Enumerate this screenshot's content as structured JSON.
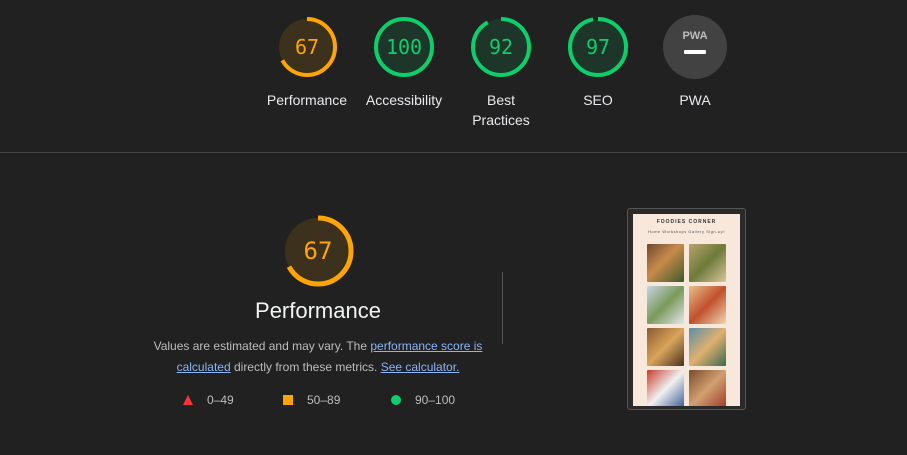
{
  "categories": [
    {
      "id": "performance",
      "score": "67",
      "label": "Performance",
      "fraction": 0.67,
      "color": "#ffa400"
    },
    {
      "id": "accessibility",
      "score": "100",
      "label": "Accessibility",
      "fraction": 1.0,
      "color": "#0cce6b"
    },
    {
      "id": "best-practices",
      "score": "92",
      "label": "Best Practices",
      "fraction": 0.92,
      "color": "#0cce6b"
    },
    {
      "id": "seo",
      "score": "97",
      "label": "SEO",
      "fraction": 0.97,
      "color": "#0cce6b"
    },
    {
      "id": "pwa",
      "score": "PWA",
      "label": "PWA",
      "fraction": null,
      "color": "#9e9e9e"
    }
  ],
  "detail": {
    "score": "67",
    "fraction": 0.67,
    "title": "Performance",
    "desc_part1": "Values are estimated and may vary. The ",
    "link1": "performance score is calculated",
    "desc_part2": " directly from these metrics. ",
    "link2": "See calculator."
  },
  "legend": {
    "fail": "0–49",
    "average": "50–89",
    "pass": "90–100"
  },
  "colors": {
    "fail": "#ff3333",
    "average": "#ffa400",
    "pass": "#0cce6b"
  },
  "screenshot": {
    "site_title": "FOODIES CORNER",
    "nav": "Home  Workshops  Gallery  Sign-up!"
  }
}
